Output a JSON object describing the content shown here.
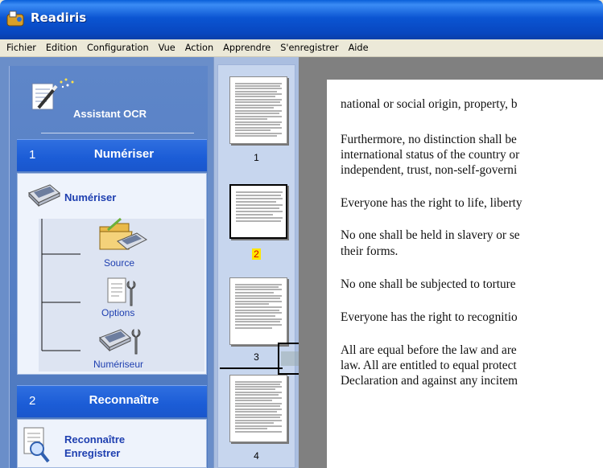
{
  "window": {
    "title": "Readiris"
  },
  "menu": [
    "Fichier",
    "Edition",
    "Configuration",
    "Vue",
    "Action",
    "Apprendre",
    "S'enregistrer",
    "Aide"
  ],
  "wizard": {
    "assistant_label": "Assistant OCR",
    "step1": {
      "number": "1",
      "title": "Numériser",
      "group_label": "Numériser",
      "items": [
        {
          "label": "Source",
          "icon": "folder-scanner-icon"
        },
        {
          "label": "Options",
          "icon": "document-wrench-icon"
        },
        {
          "label": "Numériseur",
          "icon": "scanner-wrench-icon"
        }
      ]
    },
    "step2": {
      "number": "2",
      "title": "Reconnaître",
      "group_label_line1": "Reconnaître",
      "group_label_line2": "Enregistrer"
    }
  },
  "thumbnails": [
    {
      "label": "1",
      "selected": false
    },
    {
      "label": "2",
      "selected": true
    },
    {
      "label": "3",
      "selected": false
    },
    {
      "label": "4",
      "selected": false
    }
  ],
  "document": {
    "lines": [
      "national or social origin, property, b",
      "Furthermore, no distinction shall be",
      "international status of the country or",
      "independent, trust, non-self-governi",
      "Everyone has the right to life, liberty",
      "No one shall be held in slavery or se",
      "their forms.",
      "No one shall be subjected to torture",
      "Everyone has the right to recognitio",
      "All are equal before the law and are",
      "law. All are entitled to equal protect",
      "Declaration and against any incitem"
    ]
  },
  "colors": {
    "titlebar": "#0846bf",
    "wizard_panel": "#5e86c9",
    "step_header": "#1b5cd6",
    "link_text": "#1e3fb0",
    "selected_page_highlight": "#ffe600",
    "selected_page_number": "#d40000"
  }
}
